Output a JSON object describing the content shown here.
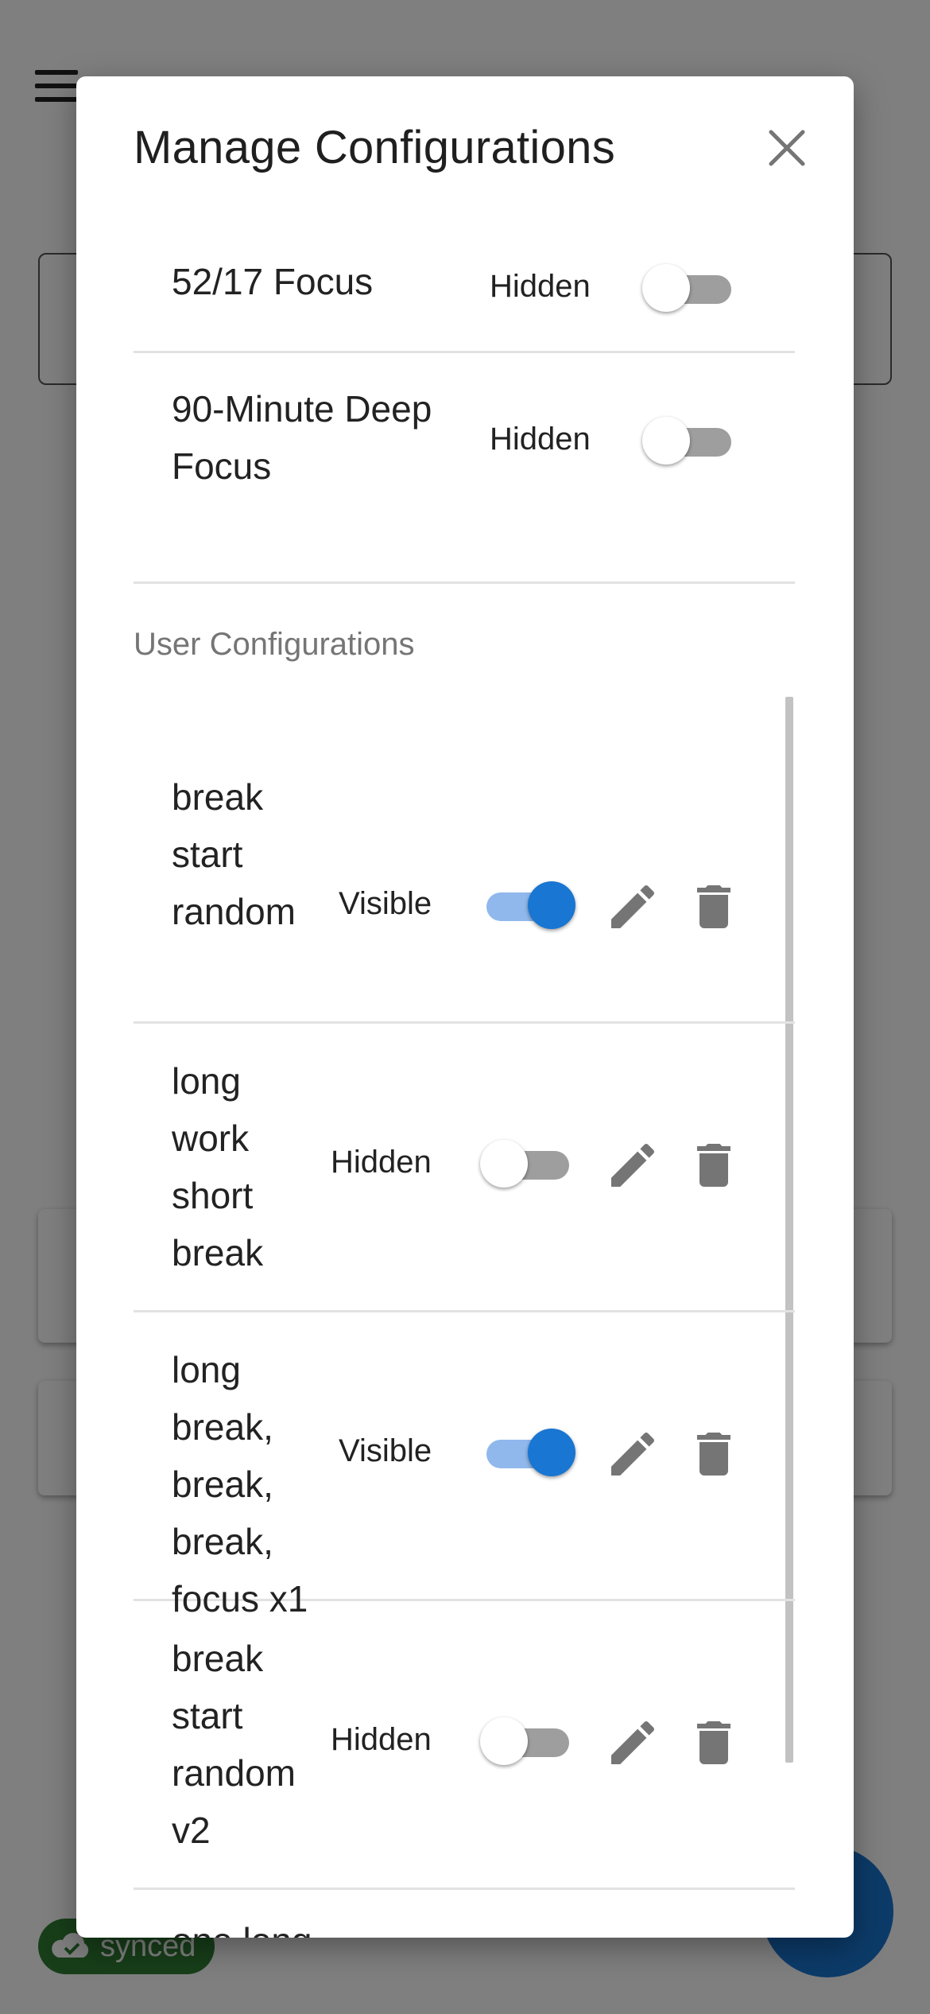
{
  "background": {
    "synced_label": "synced"
  },
  "dialog": {
    "title": "Manage Configurations",
    "default_configs": [
      {
        "name": "52/17 Focus",
        "status": "Hidden",
        "visible": false
      },
      {
        "name": "90-Minute Deep Focus",
        "status": "Hidden",
        "visible": false
      }
    ],
    "user_section_label": "User Configurations",
    "user_configs": [
      {
        "name": "break start random",
        "status": "Visible",
        "visible": true
      },
      {
        "name": "long work short break",
        "status": "Hidden",
        "visible": false
      },
      {
        "name": "long break, break, break, focus x1",
        "status": "Visible",
        "visible": true
      },
      {
        "name": "break start random v2",
        "status": "Hidden",
        "visible": false
      },
      {
        "name": "one long",
        "status": "",
        "visible": false
      }
    ]
  },
  "icons": {
    "close": "close-icon",
    "edit": "pencil-icon",
    "delete": "trash-icon",
    "menu": "hamburger-menu-icon",
    "cloud": "cloud-check-icon"
  },
  "colors": {
    "accent": "#1976d2",
    "accent_track": "#90b8ec",
    "synced_badge": "#2e7d32"
  }
}
